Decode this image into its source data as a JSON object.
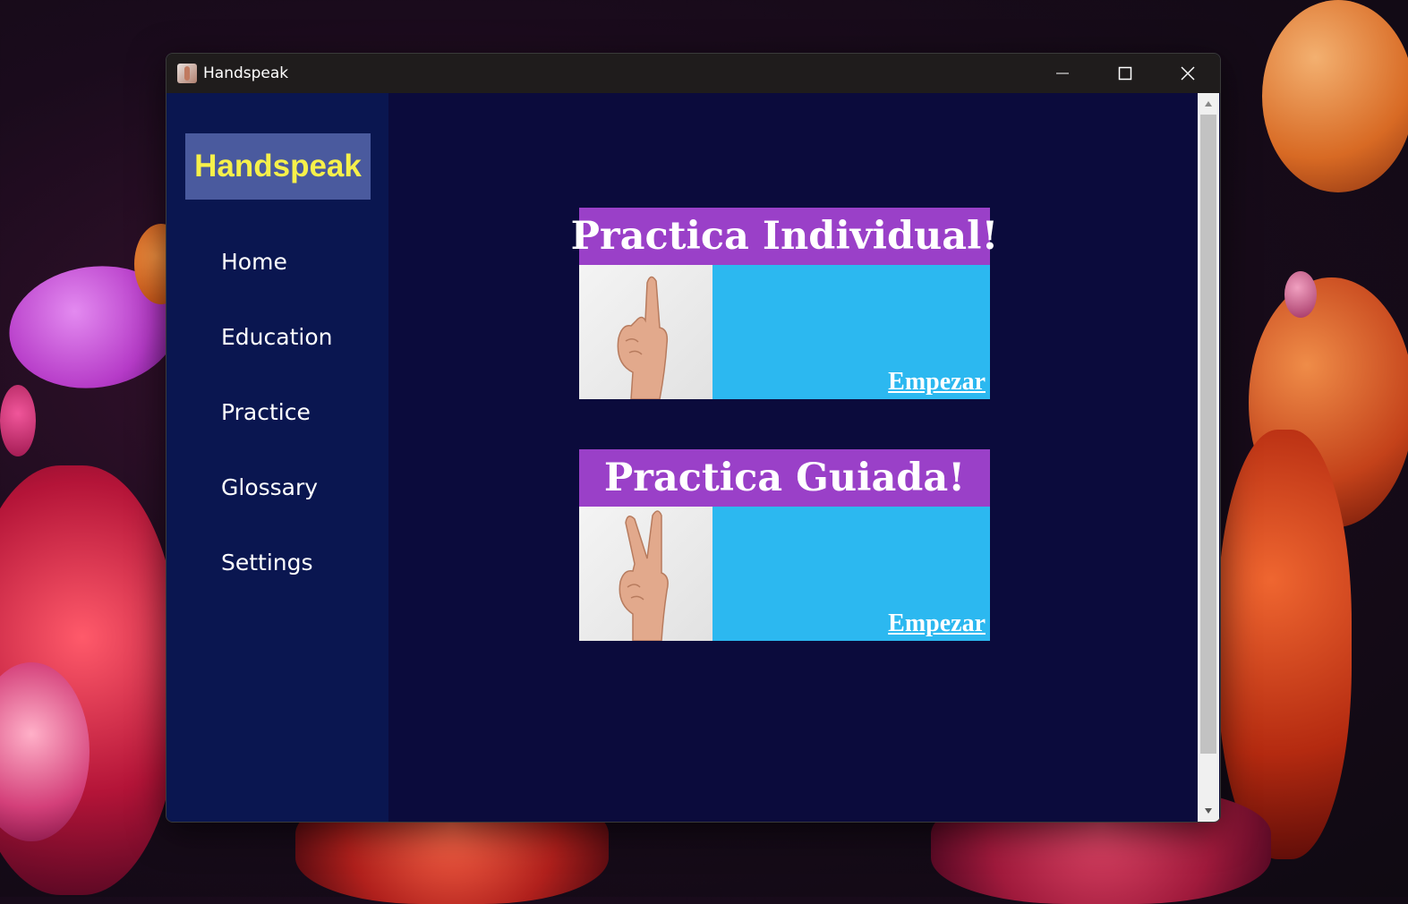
{
  "window": {
    "title": "Handspeak"
  },
  "sidebar": {
    "brand": "Handspeak",
    "items": [
      {
        "label": "Home"
      },
      {
        "label": "Education"
      },
      {
        "label": "Practice"
      },
      {
        "label": "Glossary"
      },
      {
        "label": "Settings"
      }
    ]
  },
  "main": {
    "cards": [
      {
        "title": "Practica Individual!",
        "link": "Empezar",
        "image": "one-finger-hand-photo"
      },
      {
        "title": "Practica Guiada!",
        "link": "Empezar",
        "image": "two-finger-hand-photo"
      }
    ]
  },
  "colors": {
    "sidebar_bg": "#0a1650",
    "content_bg": "#0b0b3c",
    "brand_bg": "#4a5a9e",
    "brand_text": "#f6f04a",
    "card_header": "#9a40c8",
    "card_body": "#2cb8f0"
  }
}
